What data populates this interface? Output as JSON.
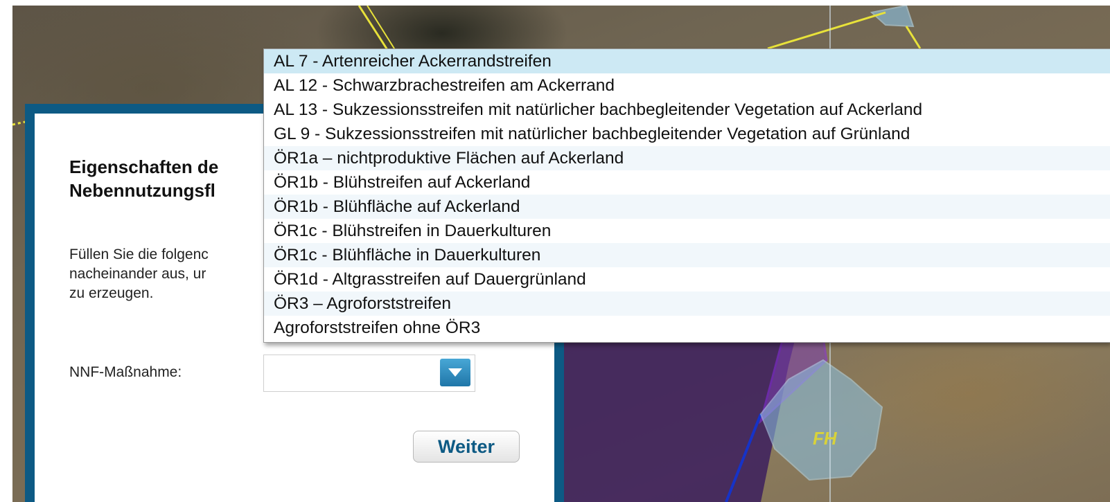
{
  "map": {
    "field_label": "FH"
  },
  "dialog": {
    "title_line1": "Eigenschaften de",
    "title_line2": "Nebennutzungsfl",
    "text_line1": "Füllen Sie die folgenc",
    "text_line2": "nacheinander aus, ur",
    "text_line3": "zu erzeugen.",
    "nnf_label": "NNF-Maßnahme:",
    "select_value": "",
    "dropdown_icon": "chevron-down-icon",
    "next_button": "Weiter"
  },
  "dropdown": {
    "selected_index": 0,
    "options": [
      "AL 7 - Artenreicher Ackerrandstreifen",
      "AL 12 - Schwarzbrachestreifen am Ackerrand",
      "AL 13 - Sukzessionsstreifen mit natürlicher bachbegleitender Vegetation auf Ackerland",
      "GL 9 - Sukzessionsstreifen mit natürlicher bachbegleitender Vegetation auf Grünland",
      "ÖR1a – nichtproduktive Flächen auf Ackerland",
      "ÖR1b - Blühstreifen auf Ackerland",
      "ÖR1b - Blühfläche auf Ackerland",
      "ÖR1c - Blühstreifen in Dauerkulturen",
      "ÖR1c - Blühfläche in Dauerkulturen",
      "ÖR1d - Altgrasstreifen auf Dauergrünland",
      "ÖR3 – Agroforststreifen",
      "Agroforststreifen ohne ÖR3"
    ]
  },
  "colors": {
    "dialog_border": "#0d5a84",
    "selected_option": "#cde9f4",
    "button_text": "#0d5a84"
  }
}
